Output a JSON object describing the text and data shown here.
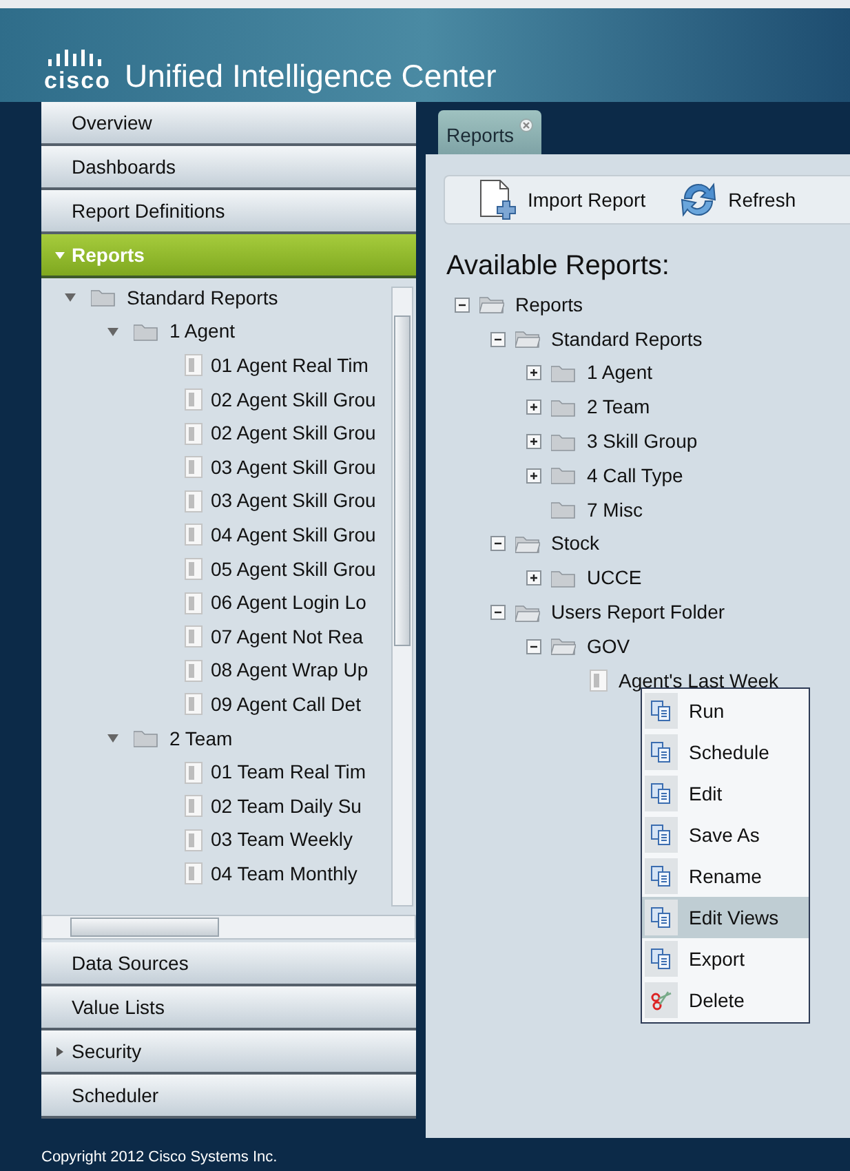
{
  "header": {
    "logo_text": "cisco",
    "title": "Unified Intelligence Center"
  },
  "nav_top": [
    {
      "label": "Overview",
      "selected": false,
      "kind": "plain"
    },
    {
      "label": "Dashboards",
      "selected": false,
      "kind": "plain"
    },
    {
      "label": "Report Definitions",
      "selected": false,
      "kind": "plain"
    },
    {
      "label": "Reports",
      "selected": true,
      "kind": "group",
      "expanded": true
    }
  ],
  "nav_tree": [
    {
      "label": "Standard Reports",
      "kind": "folder",
      "expanded": true,
      "children": [
        {
          "label": "1 Agent",
          "kind": "folder",
          "expanded": true,
          "children": [
            {
              "label": "01 Agent Real Tim",
              "kind": "report"
            },
            {
              "label": "02 Agent Skill Grou",
              "kind": "report"
            },
            {
              "label": "02 Agent Skill Grou",
              "kind": "report"
            },
            {
              "label": "03 Agent Skill Grou",
              "kind": "report"
            },
            {
              "label": "03 Agent Skill Grou",
              "kind": "report"
            },
            {
              "label": "04 Agent Skill Grou",
              "kind": "report"
            },
            {
              "label": "05 Agent Skill Grou",
              "kind": "report"
            },
            {
              "label": "06 Agent Login Lo",
              "kind": "report"
            },
            {
              "label": "07 Agent Not Rea",
              "kind": "report"
            },
            {
              "label": "08 Agent Wrap Up",
              "kind": "report"
            },
            {
              "label": "09 Agent Call Det",
              "kind": "report"
            }
          ]
        },
        {
          "label": "2 Team",
          "kind": "folder",
          "expanded": true,
          "children": [
            {
              "label": "01 Team Real Tim",
              "kind": "report"
            },
            {
              "label": "02 Team Daily Su",
              "kind": "report"
            },
            {
              "label": "03 Team Weekly",
              "kind": "report"
            },
            {
              "label": "04 Team Monthly",
              "kind": "report"
            }
          ]
        }
      ]
    }
  ],
  "nav_bottom": [
    {
      "label": "Data Sources",
      "selected": false,
      "kind": "plain"
    },
    {
      "label": "Value Lists",
      "selected": false,
      "kind": "plain"
    },
    {
      "label": "Security",
      "selected": false,
      "kind": "group",
      "expanded": false
    },
    {
      "label": "Scheduler",
      "selected": false,
      "kind": "plain"
    }
  ],
  "tabs": [
    {
      "label": "Reports",
      "selected": true
    }
  ],
  "toolbar": [
    {
      "label": "Import Report",
      "kind": "import"
    },
    {
      "label": "Refresh",
      "kind": "refresh"
    }
  ],
  "heading": "Available Reports:",
  "tree": [
    {
      "label": "Reports",
      "kind": "folder",
      "expanded": true,
      "children": [
        {
          "label": "Standard Reports",
          "kind": "folder",
          "expanded": true,
          "children": [
            {
              "label": "1 Agent",
              "kind": "folder",
              "expanded": false
            },
            {
              "label": "2 Team",
              "kind": "folder",
              "expanded": false
            },
            {
              "label": "3 Skill Group",
              "kind": "folder",
              "expanded": false
            },
            {
              "label": "4 Call Type",
              "kind": "folder",
              "expanded": false
            },
            {
              "label": "7 Misc",
              "kind": "empty-folder"
            }
          ]
        },
        {
          "label": "Stock",
          "kind": "folder",
          "expanded": true,
          "children": [
            {
              "label": "UCCE",
              "kind": "folder",
              "expanded": false
            }
          ]
        },
        {
          "label": "Users Report Folder",
          "kind": "folder",
          "expanded": true,
          "children": [
            {
              "label": "GOV",
              "kind": "folder",
              "expanded": true,
              "children": [
                {
                  "label": "Agent's Last Week",
                  "kind": "report"
                }
              ]
            }
          ]
        }
      ]
    }
  ],
  "context_menu": [
    {
      "label": "Run",
      "kind": "action",
      "selected": false
    },
    {
      "label": "Schedule",
      "kind": "action",
      "selected": false
    },
    {
      "label": "Edit",
      "kind": "action",
      "selected": false
    },
    {
      "label": "Save As",
      "kind": "action",
      "selected": false
    },
    {
      "label": "Rename",
      "kind": "action",
      "selected": false
    },
    {
      "label": "Edit Views",
      "kind": "action",
      "selected": true
    },
    {
      "label": "Export",
      "kind": "action",
      "selected": false
    },
    {
      "label": "Delete",
      "kind": "delete",
      "selected": false
    }
  ],
  "footer": "Copyright 2012 Cisco Systems Inc."
}
